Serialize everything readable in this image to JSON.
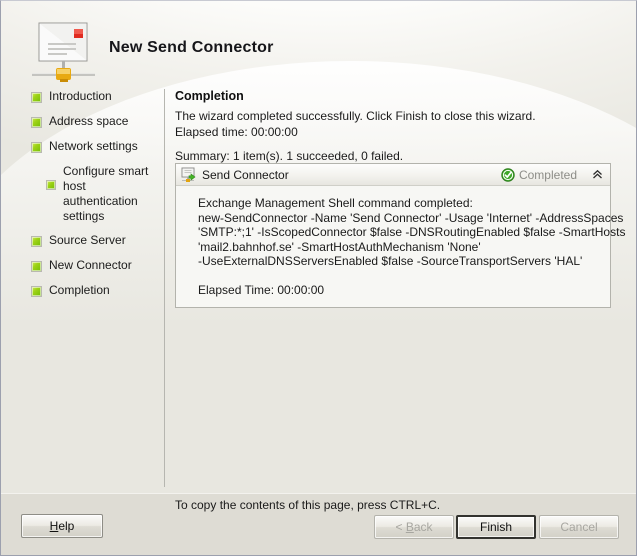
{
  "window": {
    "title": "New Send Connector",
    "icon": "send-connector-wizard-icon"
  },
  "sidebar": {
    "items": [
      {
        "label": "Introduction",
        "state": "complete",
        "sub": false
      },
      {
        "label": "Address space",
        "state": "complete",
        "sub": false
      },
      {
        "label": "Network settings",
        "state": "complete",
        "sub": false
      },
      {
        "label": "Configure smart host authentication settings",
        "state": "complete",
        "sub": true
      },
      {
        "label": "Source Server",
        "state": "complete",
        "sub": false
      },
      {
        "label": "New Connector",
        "state": "complete",
        "sub": false
      },
      {
        "label": "Completion",
        "state": "complete",
        "sub": false
      }
    ]
  },
  "main": {
    "heading": "Completion",
    "description": "The wizard completed successfully. Click Finish to close this wizard.",
    "elapsed_time": "Elapsed time: 00:00:00",
    "summary": "Summary: 1 item(s). 1 succeeded, 0 failed."
  },
  "result": {
    "name": "Send Connector",
    "icon": "send-connector-icon",
    "status_icon": "green-check-icon",
    "status_text": "Completed",
    "collapse_icon": "double-chevron-up-icon",
    "command_heading": "Exchange Management Shell command completed:",
    "command_lines": [
      "new-SendConnector -Name 'Send Connector' -Usage 'Internet' -AddressSpaces",
      "'SMTP:*;1' -IsScopedConnector $false -DNSRoutingEnabled $false -SmartHosts",
      "'mail2.bahnhof.se' -SmartHostAuthMechanism 'None'",
      "-UseExternalDNSServersEnabled $false -SourceTransportServers 'HAL'"
    ],
    "elapsed": "Elapsed Time: 00:00:00"
  },
  "footer": {
    "copy_hint": "To copy the contents of this page, press CTRL+C.",
    "buttons": {
      "help": {
        "mnemonic": "H",
        "rest": "elp",
        "enabled": true
      },
      "back": {
        "prefix": "< ",
        "mnemonic": "B",
        "rest": "ack",
        "enabled": false
      },
      "finish": {
        "label": "Finish",
        "enabled": true,
        "default": true
      },
      "cancel": {
        "label": "Cancel",
        "enabled": false
      }
    }
  },
  "colors": {
    "accent_green": "#74bd05",
    "status_gray": "#8d8d88",
    "panel_bg": "#f7f7f4",
    "footer_bg": "#dedcd4"
  }
}
